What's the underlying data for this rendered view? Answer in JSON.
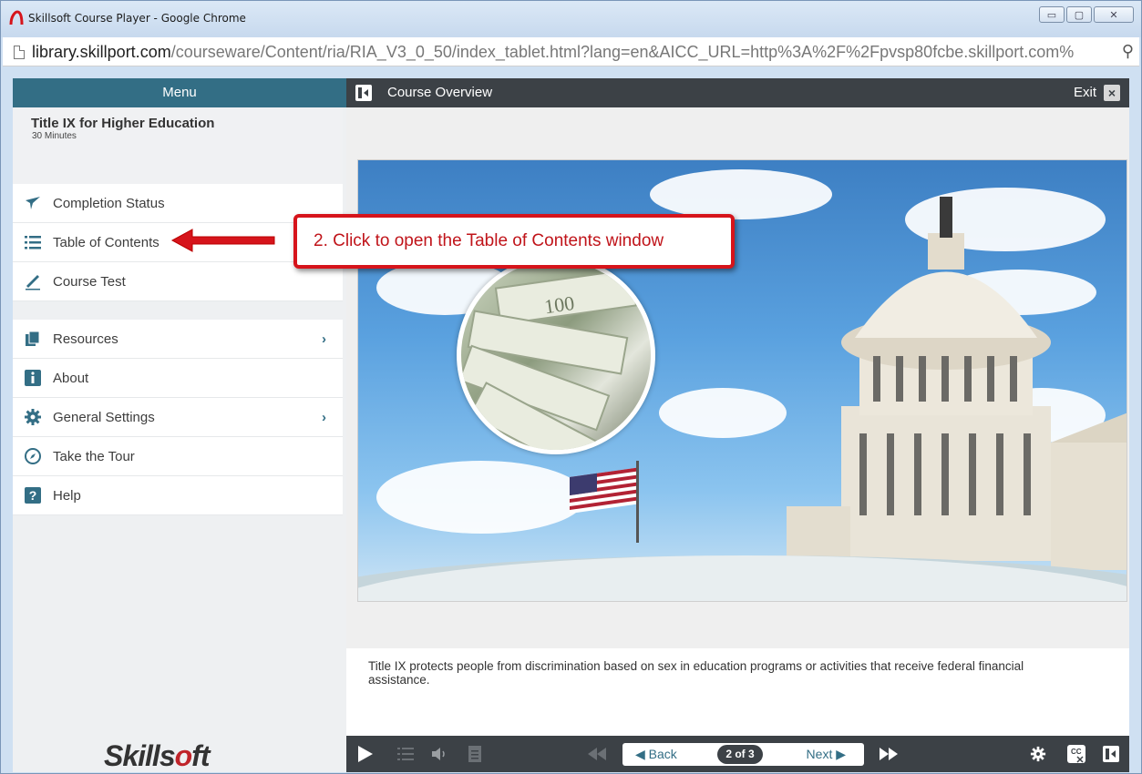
{
  "window": {
    "title": "Skillsoft Course Player - Google Chrome",
    "url_host": "library.skillport.com",
    "url_path": "/courseware/Content/ria/RIA_V3_0_50/index_tablet.html?lang=en&AICC_URL=http%3A%2F%2Fpvsp80fcbe.skillport.com%"
  },
  "header": {
    "menu_label": "Menu",
    "course_overview": "Course Overview",
    "exit_label": "Exit",
    "exit_glyph": "×"
  },
  "sidebar": {
    "course_title": "Title IX for Higher Education",
    "course_duration": "30 Minutes",
    "group1": [
      {
        "label": "Completion Status",
        "icon": "completion-status-icon"
      },
      {
        "label": "Table of Contents",
        "icon": "list-icon"
      },
      {
        "label": "Course Test",
        "icon": "pencil-icon"
      }
    ],
    "group2": [
      {
        "label": "Resources",
        "icon": "resources-icon",
        "has_submenu": true
      },
      {
        "label": "About",
        "icon": "info-icon"
      },
      {
        "label": "General Settings",
        "icon": "gear-icon",
        "has_submenu": true
      },
      {
        "label": "Take the Tour",
        "icon": "compass-icon"
      },
      {
        "label": "Help",
        "icon": "help-icon"
      }
    ],
    "chevron": "›",
    "logo_prefix": "Skills",
    "logo_o": "o",
    "logo_suffix": "ft"
  },
  "content": {
    "caption": "Title IX protects people from discrimination based on sex in education programs or activities that receive federal financial assistance."
  },
  "controls": {
    "back_label": "◀ Back",
    "page_indicator": "2 of 3",
    "next_label": "Next ▶"
  },
  "callout": {
    "text": "2. Click to open the Table of Contents window",
    "color": "#d6141b"
  }
}
